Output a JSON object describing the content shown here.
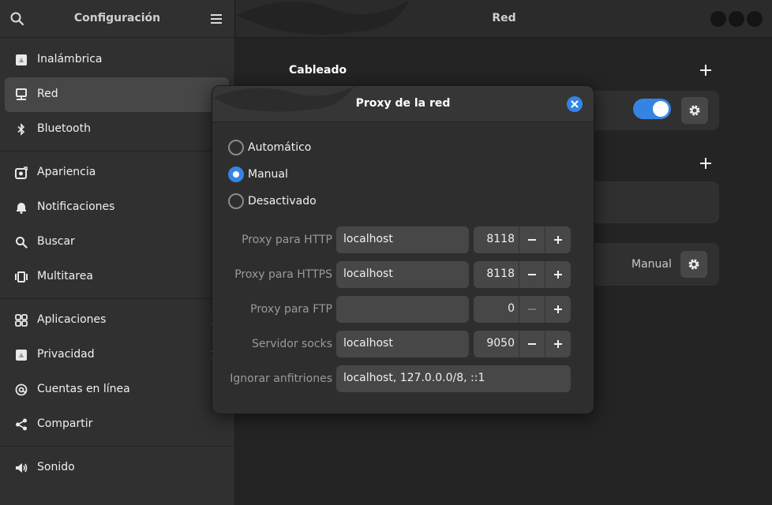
{
  "sidebar": {
    "title": "Configuración",
    "groups": [
      [
        {
          "label": "Inalámbrica",
          "icon": "wireless-icon"
        },
        {
          "label": "Red",
          "icon": "network-icon"
        },
        {
          "label": "Bluetooth",
          "icon": "bluetooth-icon"
        }
      ],
      [
        {
          "label": "Apariencia",
          "icon": "appearance-icon"
        },
        {
          "label": "Notificaciones",
          "icon": "bell-icon"
        },
        {
          "label": "Buscar",
          "icon": "search-icon"
        },
        {
          "label": "Multitarea",
          "icon": "multitask-icon"
        }
      ],
      [
        {
          "label": "Aplicaciones",
          "icon": "apps-icon"
        },
        {
          "label": "Privacidad",
          "icon": "privacy-icon"
        },
        {
          "label": "Cuentas en línea",
          "icon": "at-icon"
        },
        {
          "label": "Compartir",
          "icon": "share-icon"
        }
      ],
      [
        {
          "label": "Sonido",
          "icon": "speaker-icon"
        }
      ]
    ],
    "selected": "Red"
  },
  "main": {
    "title": "Red",
    "wired_heading": "Cableado",
    "proxy_mode": "Manual"
  },
  "dialog": {
    "title": "Proxy de la red",
    "options": {
      "automatic": "Automático",
      "manual": "Manual",
      "disabled": "Desactivado"
    },
    "selected_option": "Manual",
    "rows": {
      "http": {
        "label": "Proxy para HTTP",
        "host": "localhost",
        "port": "8118"
      },
      "https": {
        "label": "Proxy para HTTPS",
        "host": "localhost",
        "port": "8118"
      },
      "ftp": {
        "label": "Proxy para FTP",
        "host": "",
        "port": "0"
      },
      "socks": {
        "label": "Servidor socks",
        "host": "localhost",
        "port": "9050"
      },
      "ignore": {
        "label": "Ignorar anfitriones",
        "value": "localhost, 127.0.0.0/8, ::1"
      }
    }
  },
  "colors": {
    "accent": "#3584e4",
    "sidebar_bg": "#303030",
    "main_bg": "#242424"
  }
}
